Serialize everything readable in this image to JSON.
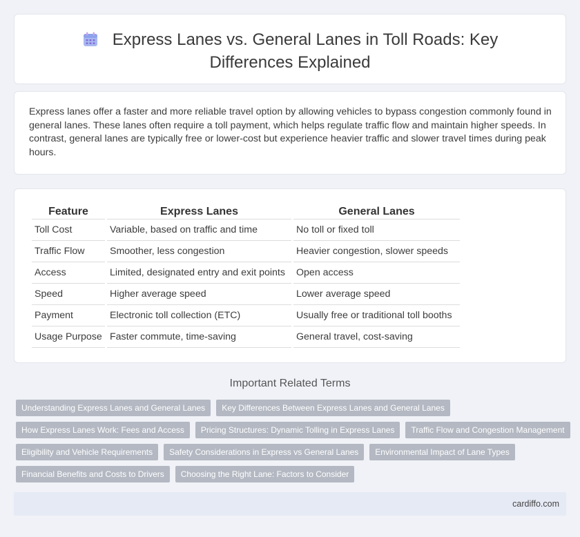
{
  "page": {
    "title": "Express Lanes vs. General Lanes in Toll Roads: Key Differences Explained",
    "title_icon": "calendar-icon"
  },
  "intro": {
    "text": "Express lanes offer a faster and more reliable travel option by allowing vehicles to bypass congestion commonly found in general lanes. These lanes often require a toll payment, which helps regulate traffic flow and maintain higher speeds. In contrast, general lanes are typically free or lower-cost but experience heavier traffic and slower travel times during peak hours."
  },
  "table": {
    "headers": [
      "Feature",
      "Express Lanes",
      "General Lanes"
    ],
    "rows": [
      [
        "Toll Cost",
        "Variable, based on traffic and time",
        "No toll or fixed toll"
      ],
      [
        "Traffic Flow",
        "Smoother, less congestion",
        "Heavier congestion, slower speeds"
      ],
      [
        "Access",
        "Limited, designated entry and exit points",
        "Open access"
      ],
      [
        "Speed",
        "Higher average speed",
        "Lower average speed"
      ],
      [
        "Payment",
        "Electronic toll collection (ETC)",
        "Usually free or traditional toll booths"
      ],
      [
        "Usage Purpose",
        "Faster commute, time-saving",
        "General travel, cost-saving"
      ]
    ]
  },
  "related": {
    "heading": "Important Related Terms",
    "tag_rows": [
      [
        "Understanding Express Lanes and General Lanes",
        "Key Differences Between Express Lanes and General Lanes"
      ],
      [
        "How Express Lanes Work: Fees and Access",
        "Pricing Structures: Dynamic Tolling in Express Lanes",
        "Traffic Flow and Congestion Management"
      ],
      [
        "Eligibility and Vehicle Requirements",
        "Safety Considerations in Express vs General Lanes",
        "Environmental Impact of Lane Types"
      ],
      [
        "Financial Benefits and Costs to Drivers",
        "Choosing the Right Lane: Factors to Consider"
      ]
    ]
  },
  "footer": {
    "site": "cardiffo.com"
  }
}
